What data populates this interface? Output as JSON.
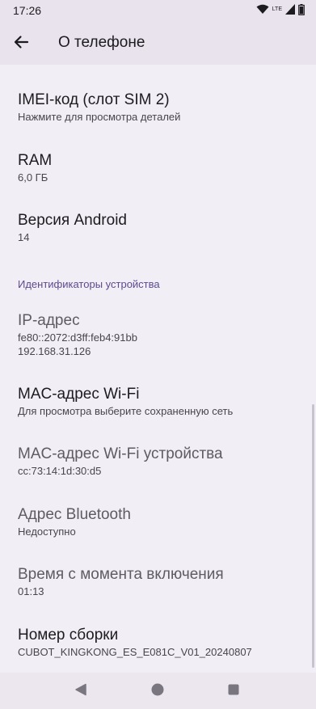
{
  "status_bar": {
    "time": "17:26",
    "network_label": "LTE",
    "icons": [
      "wifi-icon",
      "signal-icon",
      "battery-icon"
    ]
  },
  "app_bar": {
    "title": "О телефоне",
    "back_icon": "arrow-back-icon"
  },
  "items_top": [
    {
      "title": "IMEI-код (слот SIM 2)",
      "subtitle": "Нажмите для просмотра деталей"
    },
    {
      "title": "RAM",
      "subtitle": "6,0 ГБ"
    },
    {
      "title": "Версия Android",
      "subtitle": "14"
    }
  ],
  "section": {
    "title": "Идентификаторы устройства"
  },
  "items_ids": [
    {
      "title": "IP-адрес",
      "subtitle_lines": [
        "fe80::2072:d3ff:feb4:91bb",
        "192.168.31.126"
      ]
    },
    {
      "title": "MAC-адрес Wi-Fi",
      "subtitle": "Для просмотра выберите сохраненную сеть"
    },
    {
      "title": "MAC-адрес Wi-Fi устройства",
      "subtitle": "cc:73:14:1d:30:d5"
    },
    {
      "title": "Адрес Bluetooth",
      "subtitle": "Недоступно"
    },
    {
      "title": "Время с момента включения",
      "subtitle": "01:13"
    },
    {
      "title": "Номер сборки",
      "subtitle": "CUBOT_KINGKONG_ES_E081C_V01_20240807"
    }
  ],
  "nav_bar": {
    "back": "triangle-back-icon",
    "home": "circle-home-icon",
    "recents": "square-recents-icon"
  },
  "colors": {
    "background": "#f2eef5",
    "app_bar": "#e8e3ec",
    "accent": "#5d4a90"
  }
}
